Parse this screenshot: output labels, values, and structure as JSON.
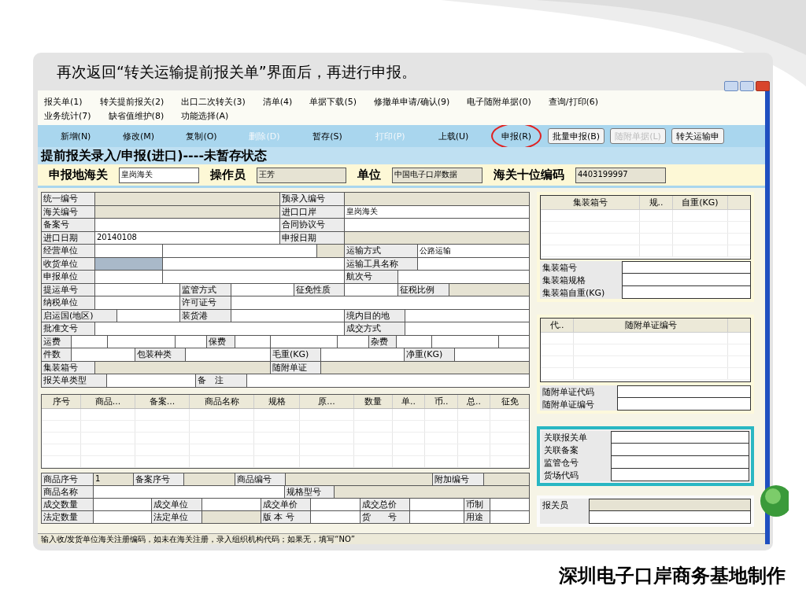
{
  "slide": {
    "caption": "再次返回“转关运输提前报关单”界面后，再进行申报。",
    "footer": "深圳电子口岸商务基地制作"
  },
  "menu": [
    [
      "报关单(1)",
      "转关提前报关(2)",
      "出口二次转关(3)",
      "清单(4)",
      "单据下载(5)",
      "修撤单申请/确认(9)",
      "电子随附单据(0)",
      "查询/打印(6)"
    ],
    [
      "业务统计(7)",
      "缺省值维护(8)",
      "功能选择(A)"
    ]
  ],
  "toolbar": [
    {
      "kind": "flat",
      "label": "新增(N)",
      "disabled": false,
      "circled": false
    },
    {
      "kind": "flat",
      "label": "修改(M)",
      "disabled": false,
      "circled": false
    },
    {
      "kind": "flat",
      "label": "复制(O)",
      "disabled": false,
      "circled": false
    },
    {
      "kind": "flat",
      "label": "删除(D)",
      "disabled": true,
      "circled": false
    },
    {
      "kind": "flat",
      "label": "暂存(S)",
      "disabled": false,
      "circled": false
    },
    {
      "kind": "flat",
      "label": "打印(P)",
      "disabled": true,
      "circled": false
    },
    {
      "kind": "flat",
      "label": "上载(U)",
      "disabled": false,
      "circled": false
    },
    {
      "kind": "flat",
      "label": "申报(R)",
      "disabled": false,
      "circled": true
    },
    {
      "kind": "raised",
      "label": "批量申报(B)",
      "disabled": false,
      "circled": false
    },
    {
      "kind": "raised",
      "label": "随附单据(L)",
      "disabled": true,
      "circled": false
    },
    {
      "kind": "raised",
      "label": "转关运输申",
      "disabled": false,
      "circled": false
    }
  ],
  "form_title": "提前报关录入/申报(进口)----未暂存状态",
  "header": [
    {
      "label": "申报地海关",
      "value": "皇岗海关",
      "readonly": false
    },
    {
      "label": "操作员",
      "value": "王芳",
      "readonly": true
    },
    {
      "label": "单位",
      "value": "中国电子口岸数据",
      "readonly": true
    },
    {
      "label": "海关十位编码",
      "value": "4403199997",
      "readonly": true
    }
  ],
  "declaration_form": [
    [
      {
        "kind": "label",
        "text": "统一编号"
      },
      {
        "kind": "field",
        "readonly": true,
        "focused": false
      },
      {
        "kind": "label",
        "text": "预录入编号"
      },
      {
        "kind": "field",
        "readonly": true,
        "focused": false
      }
    ],
    [
      {
        "kind": "label",
        "text": "海关编号"
      },
      {
        "kind": "field",
        "readonly": true,
        "focused": false
      },
      {
        "kind": "label",
        "text": "进口口岸"
      },
      {
        "kind": "field",
        "readonly": false,
        "focused": false,
        "value": "皇岗海关"
      }
    ],
    [
      {
        "kind": "label",
        "text": "备案号"
      },
      {
        "kind": "field",
        "readonly": false,
        "focused": false
      },
      {
        "kind": "label",
        "text": "合同协议号"
      },
      {
        "kind": "field",
        "readonly": false,
        "focused": false
      }
    ],
    [
      {
        "kind": "label",
        "text": "进口日期"
      },
      {
        "kind": "field",
        "readonly": false,
        "focused": false,
        "value": "20140108"
      },
      {
        "kind": "label",
        "text": "申报日期"
      },
      {
        "kind": "field",
        "readonly": true,
        "focused": false
      }
    ],
    [
      {
        "kind": "label",
        "text": "经营单位"
      },
      {
        "kind": "field",
        "readonly": false,
        "focused": false
      },
      {
        "kind": "field",
        "readonly": false,
        "focused": false
      },
      {
        "kind": "field",
        "readonly": true,
        "focused": false
      },
      {
        "kind": "label",
        "text": "运输方式"
      },
      {
        "kind": "field",
        "readonly": false,
        "focused": false,
        "value": "公路运输"
      }
    ],
    [
      {
        "kind": "label",
        "text": "收货单位"
      },
      {
        "kind": "field",
        "readonly": false,
        "focused": true
      },
      {
        "kind": "field",
        "readonly": false,
        "focused": false
      },
      {
        "kind": "label",
        "text": "运输工具名称"
      },
      {
        "kind": "field",
        "readonly": false,
        "focused": false
      }
    ],
    [
      {
        "kind": "label",
        "text": "申报单位"
      },
      {
        "kind": "field",
        "readonly": false,
        "focused": false
      },
      {
        "kind": "field",
        "readonly": false,
        "focused": false
      },
      {
        "kind": "label",
        "text": "航次号"
      },
      {
        "kind": "field",
        "readonly": false,
        "focused": false
      }
    ],
    [
      {
        "kind": "label",
        "text": "提运单号"
      },
      {
        "kind": "field",
        "readonly": false,
        "focused": false
      },
      {
        "kind": "label",
        "text": "监管方式"
      },
      {
        "kind": "field",
        "readonly": false,
        "focused": false
      },
      {
        "kind": "label",
        "text": "征免性质"
      },
      {
        "kind": "field",
        "readonly": false,
        "focused": false
      },
      {
        "kind": "label",
        "text": "征税比例"
      },
      {
        "kind": "field",
        "readonly": true,
        "focused": false
      }
    ],
    [
      {
        "kind": "label",
        "text": "纳税单位"
      },
      {
        "kind": "field",
        "readonly": false,
        "focused": false
      },
      {
        "kind": "label",
        "text": "许可证号"
      },
      {
        "kind": "field",
        "readonly": false,
        "focused": false
      }
    ],
    [
      {
        "kind": "label",
        "text": "启运国(地区)"
      },
      {
        "kind": "field",
        "readonly": false,
        "focused": false
      },
      {
        "kind": "label",
        "text": "装货港"
      },
      {
        "kind": "field",
        "readonly": false,
        "focused": false
      },
      {
        "kind": "label",
        "text": "境内目的地"
      },
      {
        "kind": "field",
        "readonly": false,
        "focused": false
      }
    ],
    [
      {
        "kind": "label",
        "text": "批准文号"
      },
      {
        "kind": "field",
        "readonly": false,
        "focused": false
      },
      {
        "kind": "label",
        "text": "成交方式"
      },
      {
        "kind": "field",
        "readonly": false,
        "focused": false
      }
    ],
    [
      {
        "kind": "label",
        "text": "运费"
      },
      {
        "kind": "field",
        "readonly": false,
        "focused": false
      },
      {
        "kind": "field",
        "readonly": false,
        "focused": false
      },
      {
        "kind": "field",
        "readonly": false,
        "focused": false
      },
      {
        "kind": "label",
        "text": "保费"
      },
      {
        "kind": "field",
        "readonly": false,
        "focused": false
      },
      {
        "kind": "field",
        "readonly": false,
        "focused": false
      },
      {
        "kind": "field",
        "readonly": false,
        "focused": false
      },
      {
        "kind": "label",
        "text": "杂费"
      },
      {
        "kind": "field",
        "readonly": false,
        "focused": false
      },
      {
        "kind": "field",
        "readonly": false,
        "focused": false
      },
      {
        "kind": "field",
        "readonly": false,
        "focused": false
      }
    ],
    [
      {
        "kind": "label",
        "text": "件数"
      },
      {
        "kind": "field",
        "readonly": false,
        "focused": false
      },
      {
        "kind": "label",
        "text": "包装种类"
      },
      {
        "kind": "field",
        "readonly": false,
        "focused": false
      },
      {
        "kind": "label",
        "text": "毛重(KG)"
      },
      {
        "kind": "field",
        "readonly": false,
        "focused": false
      },
      {
        "kind": "label",
        "text": "净重(KG)"
      },
      {
        "kind": "field",
        "readonly": false,
        "focused": false
      }
    ],
    [
      {
        "kind": "label",
        "text": "集装箱号"
      },
      {
        "kind": "field",
        "readonly": true,
        "focused": false
      },
      {
        "kind": "label",
        "text": "随附单证"
      },
      {
        "kind": "field",
        "readonly": true,
        "focused": false
      }
    ],
    [
      {
        "kind": "label",
        "text": "报关单类型"
      },
      {
        "kind": "field",
        "readonly": false,
        "focused": false
      },
      {
        "kind": "label",
        "text": "备　注"
      },
      {
        "kind": "field",
        "readonly": false,
        "focused": false
      }
    ]
  ],
  "items_table": {
    "columns": [
      "序号",
      "商品...",
      "备案...",
      "商品名称",
      "规格",
      "原...",
      "数量",
      "单..",
      "币..",
      "总..",
      "征免"
    ]
  },
  "goods_form": [
    [
      {
        "kind": "label",
        "text": "商品序号"
      },
      {
        "kind": "field",
        "readonly": true,
        "focused": false,
        "value": "1"
      },
      {
        "kind": "label",
        "text": "备案序号"
      },
      {
        "kind": "field",
        "readonly": true,
        "focused": false
      },
      {
        "kind": "label",
        "text": "商品编号"
      },
      {
        "kind": "field",
        "readonly": true,
        "focused": false
      },
      {
        "kind": "label",
        "text": "附加编号"
      },
      {
        "kind": "field",
        "readonly": true,
        "focused": false
      }
    ],
    [
      {
        "kind": "label",
        "text": "商品名称"
      },
      {
        "kind": "field",
        "readonly": false,
        "focused": false
      },
      {
        "kind": "label",
        "text": "规格型号"
      },
      {
        "kind": "field",
        "readonly": true,
        "focused": false
      }
    ],
    [
      {
        "kind": "label",
        "text": "成交数量"
      },
      {
        "kind": "field",
        "readonly": false,
        "focused": false
      },
      {
        "kind": "label",
        "text": "成交单位"
      },
      {
        "kind": "field",
        "readonly": false,
        "focused": false
      },
      {
        "kind": "label",
        "text": "成交单价"
      },
      {
        "kind": "field",
        "readonly": false,
        "focused": false
      },
      {
        "kind": "label",
        "text": "成交总价"
      },
      {
        "kind": "field",
        "readonly": false,
        "focused": false
      },
      {
        "kind": "label",
        "text": "币制"
      },
      {
        "kind": "field",
        "readonly": false,
        "focused": false
      }
    ],
    [
      {
        "kind": "label",
        "text": "法定数量"
      },
      {
        "kind": "field",
        "readonly": false,
        "focused": false
      },
      {
        "kind": "label",
        "text": "法定单位"
      },
      {
        "kind": "field",
        "readonly": true,
        "focused": false
      },
      {
        "kind": "label",
        "text": "版 本 号"
      },
      {
        "kind": "field",
        "readonly": false,
        "focused": false
      },
      {
        "kind": "label",
        "text": "货　　号"
      },
      {
        "kind": "field",
        "readonly": false,
        "focused": false
      },
      {
        "kind": "label",
        "text": "用途"
      },
      {
        "kind": "field",
        "readonly": false,
        "focused": false
      }
    ]
  ],
  "container_panel": {
    "columns": [
      "集装箱号",
      "规..",
      "自重(KG)"
    ],
    "fields": [
      {
        "label": "集装箱号",
        "readonly": false
      },
      {
        "label": "集装箱规格",
        "readonly": false
      },
      {
        "label": "集装箱自重(KG)",
        "readonly": false
      }
    ]
  },
  "documents_panel": {
    "columns": [
      "代..",
      "随附单证编号"
    ],
    "fields": [
      {
        "label": "随附单证代码",
        "readonly": false
      },
      {
        "label": "随附单证编号",
        "readonly": false
      }
    ]
  },
  "related_panel": {
    "fields": [
      {
        "label": "关联报关单",
        "readonly": false
      },
      {
        "label": "关联备案",
        "readonly": false
      },
      {
        "label": "监管仓号",
        "readonly": false
      },
      {
        "label": "货场代码",
        "readonly": false
      }
    ]
  },
  "broker_panel": {
    "fields": [
      {
        "label": "报关员",
        "readonly": true
      },
      {
        "readonly": false
      }
    ]
  },
  "status_bar": "输入收/发货单位海关注册编码，如未在海关注册，录入组织机构代码；如果无，填写“NO”"
}
